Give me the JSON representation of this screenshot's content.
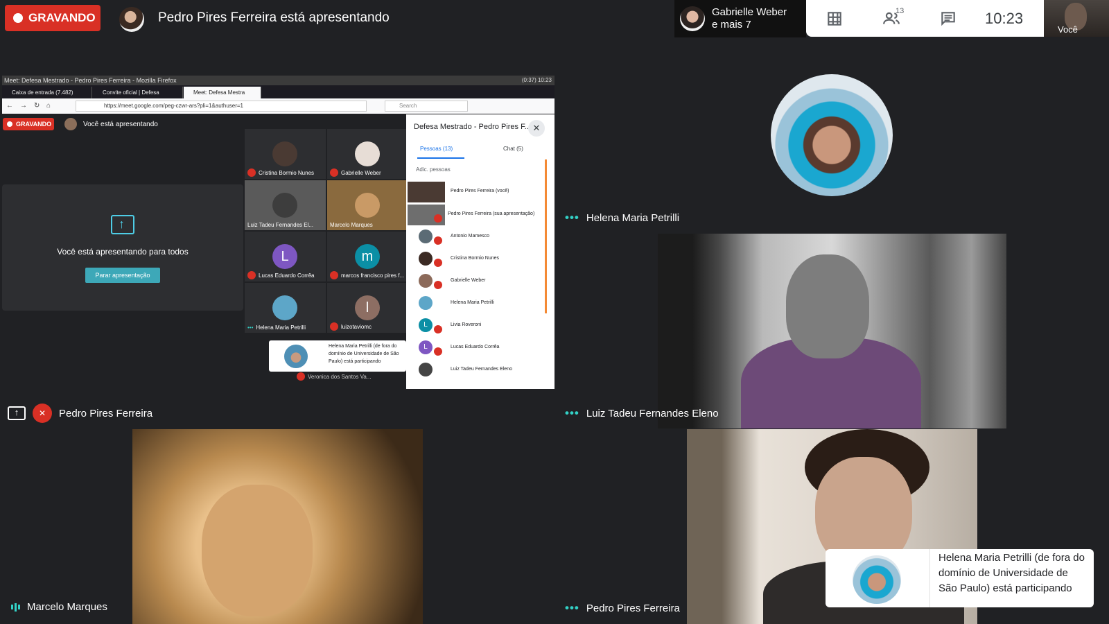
{
  "header": {
    "recording_label": "GRAVANDO",
    "presenting_title": "Pedro Pires Ferreira está apresentando"
  },
  "join_notification": {
    "line1": "Gabrielle Weber",
    "line2": "e mais 7"
  },
  "controls": {
    "people_count": "13",
    "clock": "10:23"
  },
  "self_view": {
    "label": "Você"
  },
  "shared_screen": {
    "window_title": "Meet: Defesa Mestrado - Pedro Pires Ferreira - Mozilla Firefox",
    "system_tray": "(0:37)  10:23",
    "tabs": [
      "Caixa de entrada (7.482)",
      "Convite oficial | Defesa",
      "Meet: Defesa Mestra"
    ],
    "url": "https://meet.google.com/peg-czwr-ars?pli=1&authuser=1",
    "search_placeholder": "Search",
    "recording_label": "GRAVANDO",
    "presenting_text": "Você está apresentando",
    "present_card_text": "Você está apresentando para todos",
    "stop_button": "Parar apresentação",
    "grid_tiles": [
      {
        "name": "Cristina Bormio Nunes",
        "initial": ""
      },
      {
        "name": "Gabrielle Weber",
        "initial": ""
      },
      {
        "name": "Luiz Tadeu Fernandes El...",
        "initial": ""
      },
      {
        "name": "Marcelo Marques",
        "initial": ""
      },
      {
        "name": "Lucas Eduardo Corrêa",
        "initial": "L"
      },
      {
        "name": "marcos francisco pires f...",
        "initial": "m"
      },
      {
        "name": "Helena Maria Petrilli",
        "initial": ""
      },
      {
        "name": "luizotaviomc",
        "initial": "l"
      }
    ],
    "hidden_tile_name": "Veronica dos Santos Va...",
    "panel": {
      "title": "Defesa Mestrado - Pedro Pires F...",
      "people_tab": "Pessoas (13)",
      "chat_tab": "Chat (5)",
      "add_people": "Adic. pessoas",
      "people": [
        {
          "name": "Pedro Pires Ferreira (você)",
          "initial": ""
        },
        {
          "name": "Pedro Pires Ferreira (sua apresentação)",
          "initial": ""
        },
        {
          "name": "Antonio Mamesco",
          "initial": ""
        },
        {
          "name": "Cristina Bormio Nunes",
          "initial": ""
        },
        {
          "name": "Gabrielle Weber",
          "initial": ""
        },
        {
          "name": "Helena Maria Petrilli",
          "initial": ""
        },
        {
          "name": "Livia Roveroni",
          "initial": "L"
        },
        {
          "name": "Lucas Eduardo Corrêa",
          "initial": "L"
        },
        {
          "name": "Luiz Tadeu Fernandes Eleno",
          "initial": ""
        }
      ]
    },
    "toast": "Helena Maria Petrilli (de fora do domínio de Universidade de São Paulo) está participando"
  },
  "tiles": {
    "share_owner": "Pedro Pires Ferreira",
    "helena": "Helena Maria Petrilli",
    "luiz": "Luiz Tadeu Fernandes Eleno",
    "marcelo": "Marcelo Marques",
    "pedro": "Pedro Pires Ferreira"
  },
  "toast": {
    "text": "Helena Maria Petrilli (de fora do domínio de Universidade de São Paulo) está participando"
  },
  "colors": {
    "recording": "#d93025",
    "active_speaker_dots": "#33d1c6",
    "tile_bg": "#202124"
  }
}
